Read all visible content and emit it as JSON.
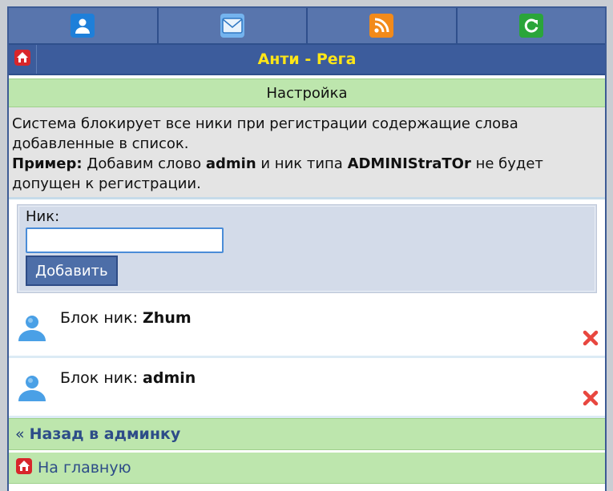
{
  "nav": {
    "items": [
      {
        "icon": "user-icon",
        "color": "#1e7fd9"
      },
      {
        "icon": "mail-icon",
        "color": "#5ea3e8"
      },
      {
        "icon": "rss-icon",
        "color": "#f28a1a"
      },
      {
        "icon": "refresh-icon",
        "color": "#2aa53a"
      }
    ]
  },
  "titlebar": {
    "title": "Анти - Рега",
    "home_icon": "home-icon"
  },
  "section": {
    "header": "Настройка"
  },
  "info": {
    "line1": "Система блокирует все ники при регистрации содержащие слова добавленные в список.",
    "example_label": "Пример:",
    "example_pre": " Добавим слово ",
    "example_word": "admin",
    "example_mid": " и ник типа ",
    "example_nick": "ADMINIStraTOr",
    "example_post": " не будет допущен к регистрации."
  },
  "form": {
    "label": "Ник:",
    "input_value": "",
    "submit_label": "Добавить"
  },
  "blocked": [
    {
      "prefix": "Блок ник: ",
      "nick": "Zhum"
    },
    {
      "prefix": "Блок ник: ",
      "nick": "admin"
    }
  ],
  "footer": {
    "back_arrow": "«",
    "back_label": "Назад в админку",
    "home_label": "На главную"
  }
}
